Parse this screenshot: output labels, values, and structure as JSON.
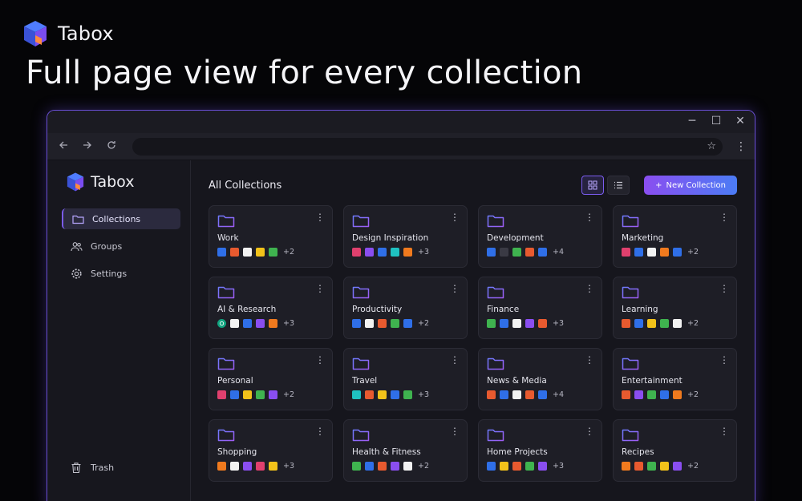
{
  "page": {
    "brand": "Tabox",
    "headline": "Full page view for every collection"
  },
  "window": {
    "controls": [
      "─",
      "☐",
      "✕"
    ],
    "star": "☆",
    "menu": "⋮"
  },
  "sidebar": {
    "brand": "Tabox",
    "items": [
      {
        "label": "Collections",
        "icon": "folder-icon",
        "active": true
      },
      {
        "label": "Groups",
        "icon": "users-icon",
        "active": false
      },
      {
        "label": "Settings",
        "icon": "gear-icon",
        "active": false
      }
    ],
    "trash": {
      "label": "Trash",
      "icon": "trash-icon"
    }
  },
  "main": {
    "title": "All Collections",
    "new_collection": "New Collection",
    "new_prefix": "+",
    "collections": [
      {
        "title": "Work",
        "colors": [
          "#2f6fe8",
          "#e85a2f",
          "#f2f2f2",
          "#f2c21a",
          "#3fb34f"
        ],
        "more": "+2"
      },
      {
        "title": "Design Inspiration",
        "colors": [
          "#e0406e",
          "#8a4ef0",
          "#2f6fe8",
          "#1fc1c1",
          "#f07a1e"
        ],
        "more": "+3"
      },
      {
        "title": "Development",
        "colors": [
          "#2f6fe8",
          "#3a3a44",
          "#3fb34f",
          "#e85a2f",
          "#2f6fe8"
        ],
        "more": "+4"
      },
      {
        "title": "Marketing",
        "colors": [
          "#e0406e",
          "#2f6fe8",
          "#f2f2f2",
          "#f07a1e",
          "#2f6fe8"
        ],
        "more": "+2"
      },
      {
        "title": "AI & Research",
        "colors": [
          "gpt",
          "#f2f2f2",
          "#2f6fe8",
          "#8a4ef0",
          "#f07a1e"
        ],
        "more": "+3"
      },
      {
        "title": "Productivity",
        "colors": [
          "#2f6fe8",
          "#f2f2f2",
          "#e85a2f",
          "#3fb34f",
          "#2f6fe8"
        ],
        "more": "+2"
      },
      {
        "title": "Finance",
        "colors": [
          "#3fb34f",
          "#2f6fe8",
          "#f2f2f2",
          "#8a4ef0",
          "#e85a2f"
        ],
        "more": "+3"
      },
      {
        "title": "Learning",
        "colors": [
          "#e85a2f",
          "#2f6fe8",
          "#f2c21a",
          "#3fb34f",
          "#f2f2f2"
        ],
        "more": "+2"
      },
      {
        "title": "Personal",
        "colors": [
          "#e0406e",
          "#2f6fe8",
          "#f2c21a",
          "#3fb34f",
          "#8a4ef0"
        ],
        "more": "+2"
      },
      {
        "title": "Travel",
        "colors": [
          "#1fc1c1",
          "#e85a2f",
          "#f2c21a",
          "#2f6fe8",
          "#3fb34f"
        ],
        "more": "+3"
      },
      {
        "title": "News & Media",
        "colors": [
          "#e85a2f",
          "#2f6fe8",
          "#f2f2f2",
          "#e85a2f",
          "#2f6fe8"
        ],
        "more": "+4"
      },
      {
        "title": "Entertainment",
        "colors": [
          "#e85a2f",
          "#8a4ef0",
          "#3fb34f",
          "#2f6fe8",
          "#f07a1e"
        ],
        "more": "+2"
      },
      {
        "title": "Shopping",
        "colors": [
          "#f07a1e",
          "#f2f2f2",
          "#8a4ef0",
          "#e0406e",
          "#f2c21a"
        ],
        "more": "+3"
      },
      {
        "title": "Health & Fitness",
        "colors": [
          "#3fb34f",
          "#2f6fe8",
          "#e85a2f",
          "#8a4ef0",
          "#f2f2f2"
        ],
        "more": "+2"
      },
      {
        "title": "Home Projects",
        "colors": [
          "#2f6fe8",
          "#f2c21a",
          "#e85a2f",
          "#3fb34f",
          "#8a4ef0"
        ],
        "more": "+3"
      },
      {
        "title": "Recipes",
        "colors": [
          "#f07a1e",
          "#e85a2f",
          "#3fb34f",
          "#f2c21a",
          "#8a4ef0"
        ],
        "more": "+2"
      }
    ]
  }
}
